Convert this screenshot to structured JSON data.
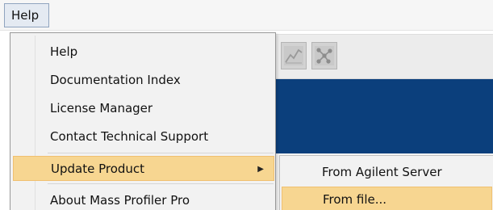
{
  "menubar": {
    "help_label": "Help"
  },
  "toolbar": {
    "buttons": [
      "chart-icon",
      "network-icon"
    ]
  },
  "menu": {
    "items": [
      {
        "label": "Help"
      },
      {
        "label": "Documentation Index"
      },
      {
        "label": "License Manager"
      },
      {
        "label": "Contact Technical Support"
      },
      {
        "label": "Update Product",
        "has_submenu": true,
        "highlighted": true
      },
      {
        "label": "About Mass Profiler Pro"
      }
    ],
    "submenu_arrow": "▶"
  },
  "submenu": {
    "items": [
      {
        "label": "From Agilent Server"
      },
      {
        "label": "From file...",
        "highlighted": true
      }
    ]
  },
  "colors": {
    "highlight": "#f7d691",
    "band": "#0b3f7c"
  }
}
